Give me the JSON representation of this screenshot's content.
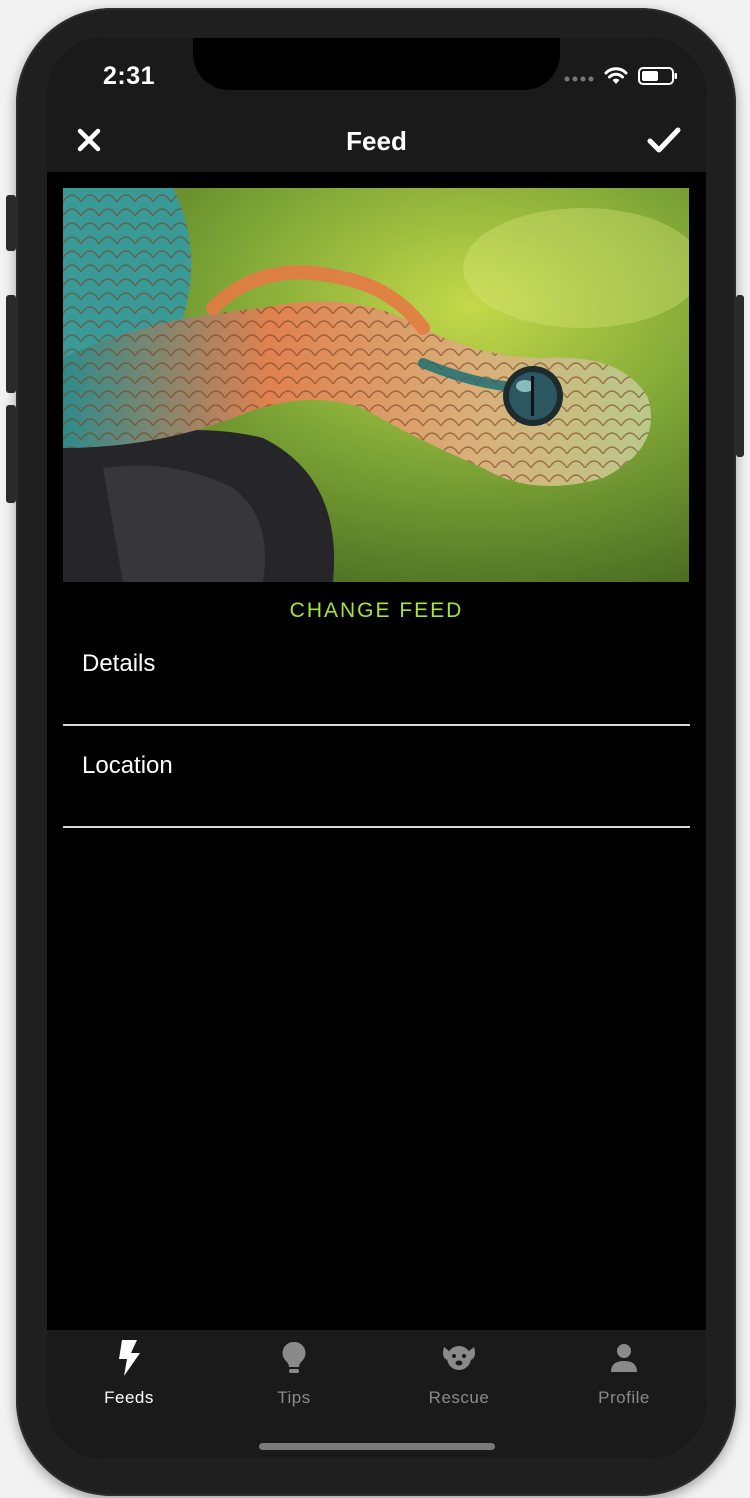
{
  "status_bar": {
    "time": "2:31"
  },
  "nav": {
    "title": "Feed",
    "close_icon": "close-icon",
    "confirm_icon": "checkmark-icon"
  },
  "feed": {
    "image_subject": "snake-photo",
    "change_label": "CHANGE FEED"
  },
  "rows": [
    {
      "label": "Details"
    },
    {
      "label": "Location"
    }
  ],
  "tabs": [
    {
      "label": "Feeds",
      "icon": "lightning-icon",
      "active": true
    },
    {
      "label": "Tips",
      "icon": "lightbulb-icon",
      "active": false
    },
    {
      "label": "Rescue",
      "icon": "dog-icon",
      "active": false
    },
    {
      "label": "Profile",
      "icon": "person-icon",
      "active": false
    }
  ],
  "colors": {
    "accent": "#a6e33e",
    "bar_background": "#1a1a1a",
    "screen_background": "#000000",
    "inactive_tab": "#8a8a8a"
  }
}
